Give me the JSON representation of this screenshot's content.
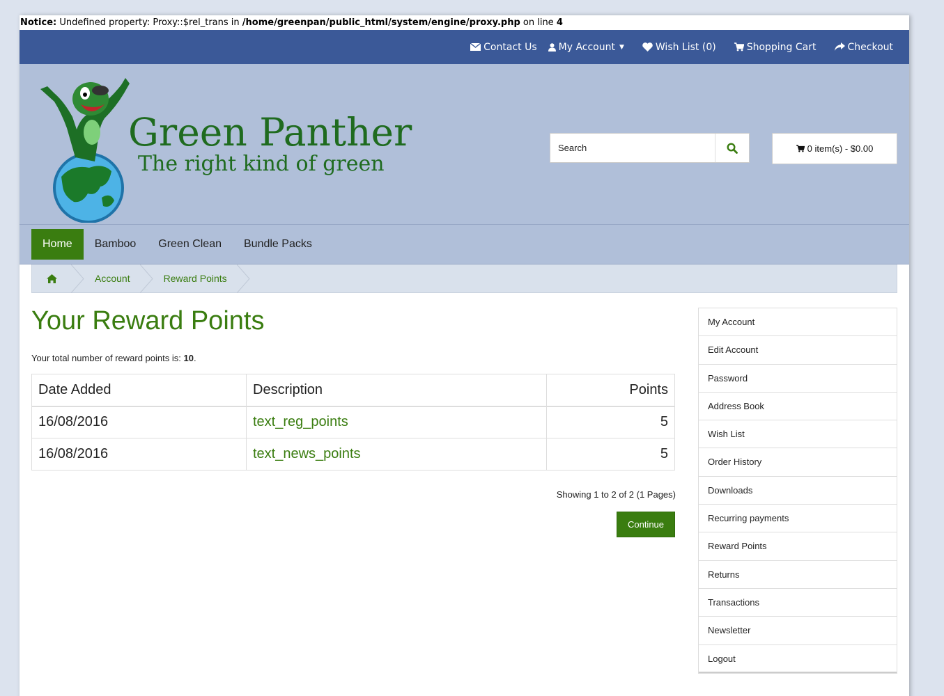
{
  "notice": {
    "label": "Notice:",
    "message": " Undefined property: Proxy::$rel_trans in ",
    "path": "/home/greenpan/public_html/system/engine/proxy.php",
    "on_line": " on line ",
    "line": "4"
  },
  "topbar": {
    "contact": "Contact Us",
    "account": "My Account",
    "wishlist": "Wish List (0)",
    "cart": "Shopping Cart",
    "checkout": "Checkout"
  },
  "header": {
    "brand_title": "Green Panther",
    "brand_subtitle": "The right kind of green",
    "search_placeholder": "Search",
    "cart_summary": "0 item(s) - $0.00"
  },
  "menu": {
    "items": [
      "Home",
      "Bamboo",
      "Green Clean",
      "Bundle Packs"
    ]
  },
  "breadcrumb": {
    "items": [
      "Account",
      "Reward Points"
    ]
  },
  "main": {
    "title": "Your Reward Points",
    "total_prefix": "Your total number of reward points is: ",
    "total_value": "10",
    "total_suffix": ".",
    "table": {
      "headers": [
        "Date Added",
        "Description",
        "Points"
      ],
      "rows": [
        [
          "16/08/2016",
          "text_reg_points",
          "5"
        ],
        [
          "16/08/2016",
          "text_news_points",
          "5"
        ]
      ]
    },
    "paging": "Showing 1 to 2 of 2 (1 Pages)",
    "continue": "Continue"
  },
  "sidebar": {
    "items": [
      "My Account",
      "Edit Account",
      "Password",
      "Address Book",
      "Wish List",
      "Order History",
      "Downloads",
      "Recurring payments",
      "Reward Points",
      "Returns",
      "Transactions",
      "Newsletter",
      "Logout"
    ]
  },
  "colors": {
    "topbar": "#3b5998",
    "header": "#b0bfd9",
    "accent_green": "#3a7d10",
    "brand_green": "#1f6b1f"
  }
}
